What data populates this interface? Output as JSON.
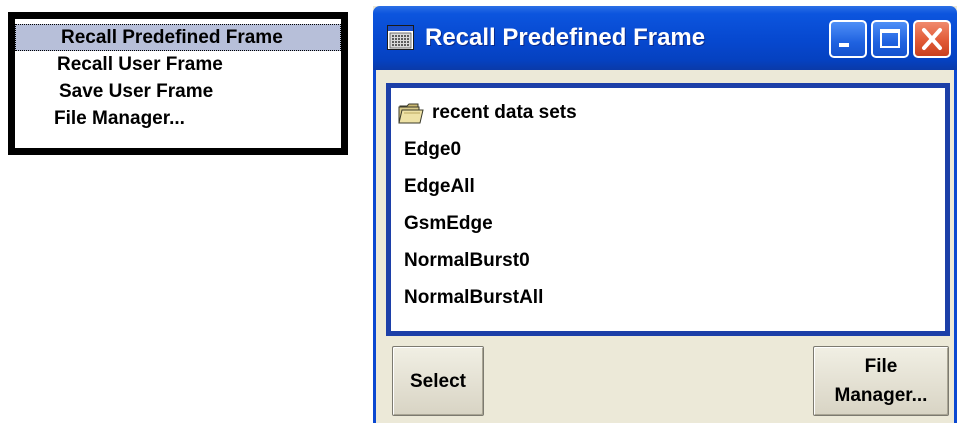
{
  "menu": {
    "items": [
      {
        "label": "Recall Predefined Frame",
        "selected": true
      },
      {
        "label": "Recall User Frame"
      },
      {
        "label": "Save User Frame"
      },
      {
        "label": "File Manager..."
      }
    ]
  },
  "dialog": {
    "title": "Recall Predefined Frame",
    "title_icon": "dialog-window-icon",
    "controls": {
      "minimize_icon": "minimize-icon",
      "maximize_icon": "maximize-icon",
      "close_icon": "close-icon"
    },
    "list": {
      "folder_label": "recent data sets",
      "folder_icon": "folder-icon",
      "items": [
        "Edge0",
        "EdgeAll",
        "GsmEdge",
        "NormalBurst0",
        "NormalBurstAll"
      ]
    },
    "buttons": {
      "select_label": "Select",
      "file_manager_line1": "File",
      "file_manager_line2": "Manager..."
    }
  },
  "colors": {
    "titlebar": "#0648cf",
    "list_border": "#1c3fa8",
    "menu_selected": "#b7bfd9",
    "dialog_bg": "#ece9d8",
    "close_button": "#e15a36"
  }
}
